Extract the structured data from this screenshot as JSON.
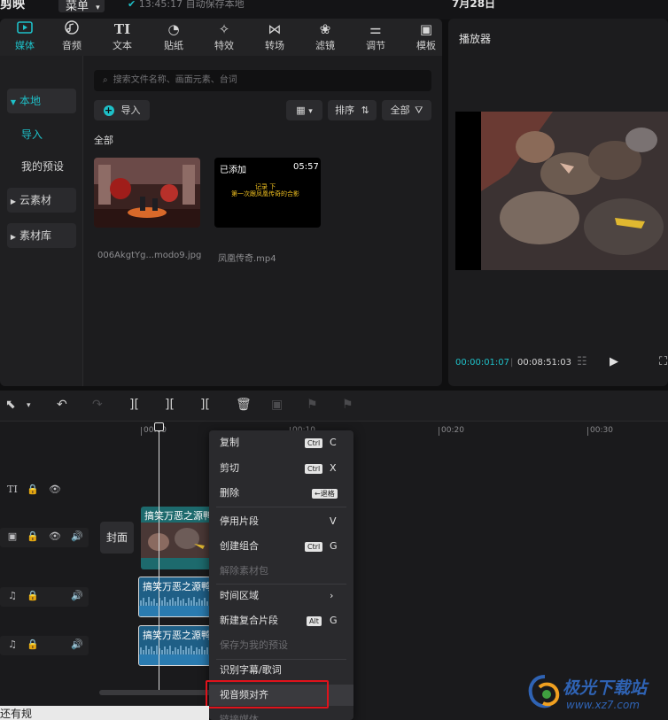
{
  "topbar": {
    "app_name": "剪映",
    "menu_label": "菜单",
    "status_text": "13:45:17 自动保存本地",
    "date": "7月28日"
  },
  "tool_tabs": [
    {
      "label": "媒体",
      "icon": "media-icon",
      "glyph": "▶",
      "active": true
    },
    {
      "label": "音频",
      "icon": "audio-icon",
      "glyph": "♫"
    },
    {
      "label": "文本",
      "icon": "text-icon",
      "glyph": "TI"
    },
    {
      "label": "贴纸",
      "icon": "sticker-icon",
      "glyph": "◔"
    },
    {
      "label": "特效",
      "icon": "effects-icon",
      "glyph": "✧"
    },
    {
      "label": "转场",
      "icon": "transition-icon",
      "glyph": "⋈"
    },
    {
      "label": "滤镜",
      "icon": "filter-icon",
      "glyph": "❀"
    },
    {
      "label": "调节",
      "icon": "adjust-icon",
      "glyph": "⚌"
    },
    {
      "label": "模板",
      "icon": "template-icon",
      "glyph": "▣"
    }
  ],
  "side_nav": {
    "local": "本地",
    "import": "导入",
    "presets": "我的预设",
    "cloud": "云素材",
    "library": "素材库"
  },
  "search": {
    "placeholder": "搜索文件名称、画面元素、台词"
  },
  "media_toolbar": {
    "import_label": "导入",
    "sort_label": "排序",
    "filter_label": "全部"
  },
  "media_section": "全部",
  "media_items": [
    {
      "name": "006AkgtYg...modo9.jpg"
    },
    {
      "name": "凤凰传奇.mp4",
      "status": "已添加",
      "duration": "05:57",
      "caption_line1": "记录 下",
      "caption_line2": "第一次跟凤凰传奇的合影"
    }
  ],
  "player": {
    "title": "播放器",
    "current_time": "00:00:01:07",
    "total_time": "00:08:51:03"
  },
  "timeline": {
    "ruler_ticks": [
      "00:00",
      "00:10",
      "00:20",
      "00:30"
    ],
    "cover_label": "封面",
    "video_clip_label": "搞笑万恶之源鸭",
    "audio_clip_label": "搞笑万恶之源鸭"
  },
  "context_menu": {
    "copy": "复制",
    "cut": "剪切",
    "delete": "删除",
    "disable": "停用片段",
    "group": "创建组合",
    "ungroup": "解除素材包",
    "time_region": "时间区域",
    "compound": "新建复合片段",
    "save_preset": "保存为我的预设",
    "recognize": "识别字幕/歌词",
    "av_align": "视音频对齐",
    "more": "链接媒体",
    "ctrl": "Ctrl",
    "alt": "Alt",
    "backspace": "←退格",
    "key_c": "C",
    "key_x": "X",
    "key_v": "V",
    "key_g": "G",
    "arrow": "›"
  },
  "bottom_strip": "还有规",
  "watermark": {
    "main": "极光下载站",
    "url": "www.xz7.com"
  },
  "colors": {
    "accent": "#1ec0c8",
    "highlight": "#e0121b",
    "video_clip": "#1d6a6d",
    "audio_clip": "#1f5f86"
  }
}
